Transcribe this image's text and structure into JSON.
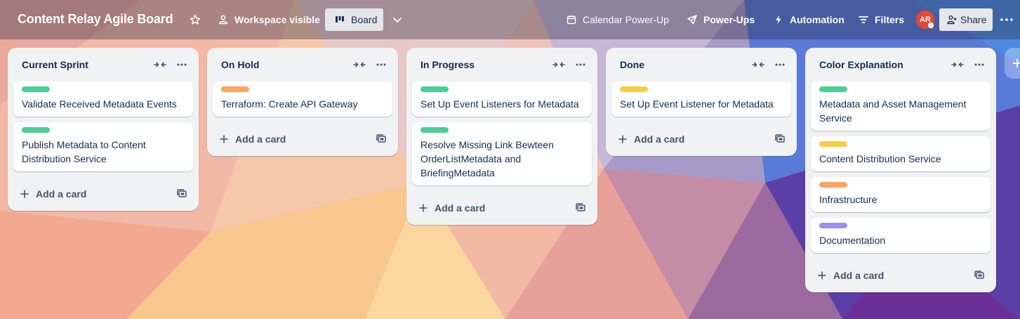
{
  "header": {
    "board_title": "Content Relay Agile Board",
    "visibility_label": "Workspace visible",
    "view_label": "Board",
    "calendar_label": "Calendar Power-Up",
    "powerups_label": "Power-Ups",
    "automation_label": "Automation",
    "filters_label": "Filters",
    "avatar_initials": "AR",
    "share_label": "Share"
  },
  "colors": {
    "green": "#4bce97",
    "yellow": "#f5cd47",
    "orange": "#fea362",
    "purple": "#9f8fef"
  },
  "add_card_label": "Add a card",
  "lists": [
    {
      "title": "Current Sprint",
      "cards": [
        {
          "label_color": "green",
          "text": "Validate Received Metadata Events"
        },
        {
          "label_color": "green",
          "text": "Publish Metadata to Content Distribution Service"
        }
      ]
    },
    {
      "title": "On Hold",
      "cards": [
        {
          "label_color": "orange",
          "text": "Terraform: Create API Gateway"
        }
      ]
    },
    {
      "title": "In Progress",
      "cards": [
        {
          "label_color": "green",
          "text": "Set Up Event Listeners for Metadata"
        },
        {
          "label_color": "green",
          "text": "Resolve Missing Link Bewteen OrderListMetadata and BriefingMetadata"
        }
      ]
    },
    {
      "title": "Done",
      "cards": [
        {
          "label_color": "yellow",
          "text": "Set Up Event Listener for Metadata"
        }
      ]
    },
    {
      "title": "Color Explanation",
      "cards": [
        {
          "label_color": "green",
          "text": "Metadata and Asset Management Service"
        },
        {
          "label_color": "yellow",
          "text": "Content Distribution Service"
        },
        {
          "label_color": "orange",
          "text": "Infrastructure"
        },
        {
          "label_color": "purple",
          "text": "Documentation"
        }
      ]
    }
  ]
}
